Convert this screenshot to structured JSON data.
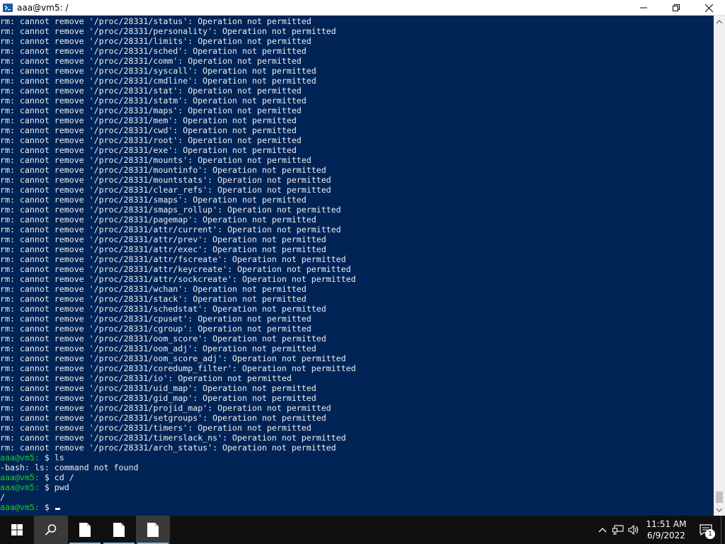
{
  "window": {
    "title": "aaa@vm5: /",
    "icon": "powershell-icon",
    "controls": [
      "minimize-icon",
      "maximize-icon",
      "close-icon"
    ]
  },
  "colors": {
    "terminal_bg": "#012456",
    "terminal_fg": "#eeedf0",
    "prompt": "#13d313",
    "taskbar_bg": "#101010"
  },
  "terminal": {
    "lines": [
      "rm: cannot remove '/proc/28331/status': Operation not permitted",
      "rm: cannot remove '/proc/28331/personality': Operation not permitted",
      "rm: cannot remove '/proc/28331/limits': Operation not permitted",
      "rm: cannot remove '/proc/28331/sched': Operation not permitted",
      "rm: cannot remove '/proc/28331/comm': Operation not permitted",
      "rm: cannot remove '/proc/28331/syscall': Operation not permitted",
      "rm: cannot remove '/proc/28331/cmdline': Operation not permitted",
      "rm: cannot remove '/proc/28331/stat': Operation not permitted",
      "rm: cannot remove '/proc/28331/statm': Operation not permitted",
      "rm: cannot remove '/proc/28331/maps': Operation not permitted",
      "rm: cannot remove '/proc/28331/mem': Operation not permitted",
      "rm: cannot remove '/proc/28331/cwd': Operation not permitted",
      "rm: cannot remove '/proc/28331/root': Operation not permitted",
      "rm: cannot remove '/proc/28331/exe': Operation not permitted",
      "rm: cannot remove '/proc/28331/mounts': Operation not permitted",
      "rm: cannot remove '/proc/28331/mountinfo': Operation not permitted",
      "rm: cannot remove '/proc/28331/mountstats': Operation not permitted",
      "rm: cannot remove '/proc/28331/clear_refs': Operation not permitted",
      "rm: cannot remove '/proc/28331/smaps': Operation not permitted",
      "rm: cannot remove '/proc/28331/smaps_rollup': Operation not permitted",
      "rm: cannot remove '/proc/28331/pagemap': Operation not permitted",
      "rm: cannot remove '/proc/28331/attr/current': Operation not permitted",
      "rm: cannot remove '/proc/28331/attr/prev': Operation not permitted",
      "rm: cannot remove '/proc/28331/attr/exec': Operation not permitted",
      "rm: cannot remove '/proc/28331/attr/fscreate': Operation not permitted",
      "rm: cannot remove '/proc/28331/attr/keycreate': Operation not permitted",
      "rm: cannot remove '/proc/28331/attr/sockcreate': Operation not permitted",
      "rm: cannot remove '/proc/28331/wchan': Operation not permitted",
      "rm: cannot remove '/proc/28331/stack': Operation not permitted",
      "rm: cannot remove '/proc/28331/schedstat': Operation not permitted",
      "rm: cannot remove '/proc/28331/cpuset': Operation not permitted",
      "rm: cannot remove '/proc/28331/cgroup': Operation not permitted",
      "rm: cannot remove '/proc/28331/oom_score': Operation not permitted",
      "rm: cannot remove '/proc/28331/oom_adj': Operation not permitted",
      "rm: cannot remove '/proc/28331/oom_score_adj': Operation not permitted",
      "rm: cannot remove '/proc/28331/coredump_filter': Operation not permitted",
      "rm: cannot remove '/proc/28331/io': Operation not permitted",
      "rm: cannot remove '/proc/28331/uid_map': Operation not permitted",
      "rm: cannot remove '/proc/28331/gid_map': Operation not permitted",
      "rm: cannot remove '/proc/28331/projid_map': Operation not permitted",
      "rm: cannot remove '/proc/28331/setgroups': Operation not permitted",
      "rm: cannot remove '/proc/28331/timers': Operation not permitted",
      "rm: cannot remove '/proc/28331/timerslack_ns': Operation not permitted",
      "rm: cannot remove '/proc/28331/arch_status': Operation not permitted"
    ],
    "session": [
      {
        "prompt": "aaa@vm5:",
        "command": " $ ls"
      },
      {
        "output": "-bash: ls: command not found"
      },
      {
        "prompt": "aaa@vm5:",
        "command": " $ cd /"
      },
      {
        "prompt": "aaa@vm5:",
        "command": " $ pwd"
      },
      {
        "output": "/"
      },
      {
        "prompt": "aaa@vm5:",
        "command": " $ "
      }
    ]
  },
  "taskbar": {
    "start_icon": "windows-logo-icon",
    "search_icon": "search-icon",
    "pinned": [
      "file-icon",
      "file-icon",
      "file-icon"
    ],
    "tray_icons": [
      "chevron-up-icon",
      "network-icon",
      "volume-icon"
    ],
    "time": "11:51 AM",
    "date": "6/9/2022",
    "notification_count": "1"
  }
}
